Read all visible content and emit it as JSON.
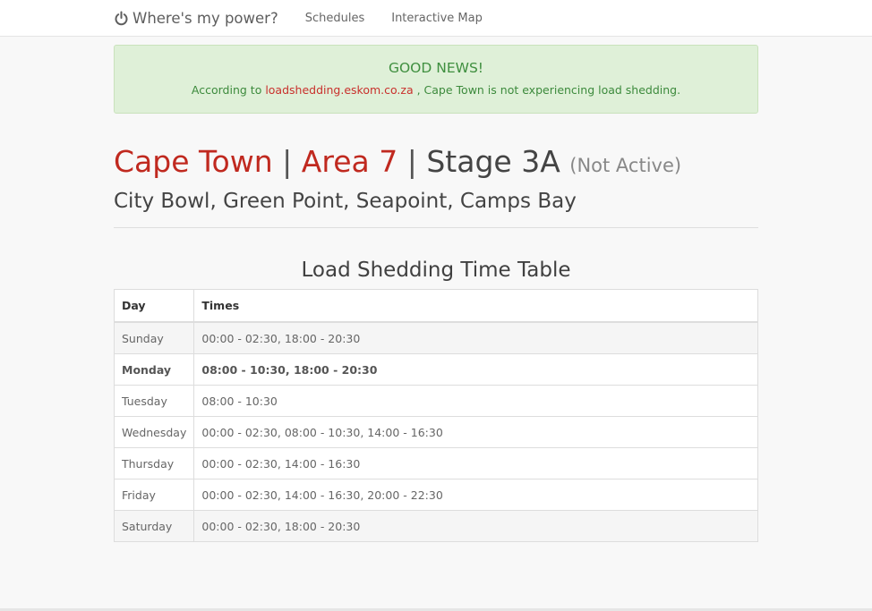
{
  "navbar": {
    "brand_label": "Where's my power?",
    "brand_icon": "power-icon",
    "links": [
      "Schedules",
      "Interactive Map"
    ]
  },
  "alert": {
    "title": "GOOD NEWS!",
    "text_before": "According to ",
    "link_text": "loadshedding.eskom.co.za",
    "text_after": " , Cape Town is not experiencing load shedding."
  },
  "heading": {
    "city": "Cape Town",
    "separator": "|",
    "area": "Area 7",
    "stage": "Stage 3A",
    "status": "(Not Active)"
  },
  "suburbs": "City Bowl, Green Point, Seapoint, Camps Bay",
  "timetable": {
    "title": "Load Shedding Time Table",
    "headers": [
      "Day",
      "Times"
    ],
    "rows": [
      {
        "day": "Sunday",
        "times": "00:00 - 02:30, 18:00 - 20:30"
      },
      {
        "day": "Monday",
        "times": "08:00 - 10:30, 18:00 - 20:30"
      },
      {
        "day": "Tuesday",
        "times": "08:00 - 10:30"
      },
      {
        "day": "Wednesday",
        "times": "00:00 - 02:30, 08:00 - 10:30, 14:00 - 16:30"
      },
      {
        "day": "Thursday",
        "times": "00:00 - 02:30, 14:00 - 16:30"
      },
      {
        "day": "Friday",
        "times": "00:00 - 02:30, 14:00 - 16:30, 20:00 - 22:30"
      },
      {
        "day": "Saturday",
        "times": "00:00 - 02:30, 18:00 - 20:30"
      }
    ]
  },
  "colors": {
    "accent_red": "#c0291f",
    "success_bg": "#dff0d8",
    "success_text": "#3c8a3c"
  }
}
